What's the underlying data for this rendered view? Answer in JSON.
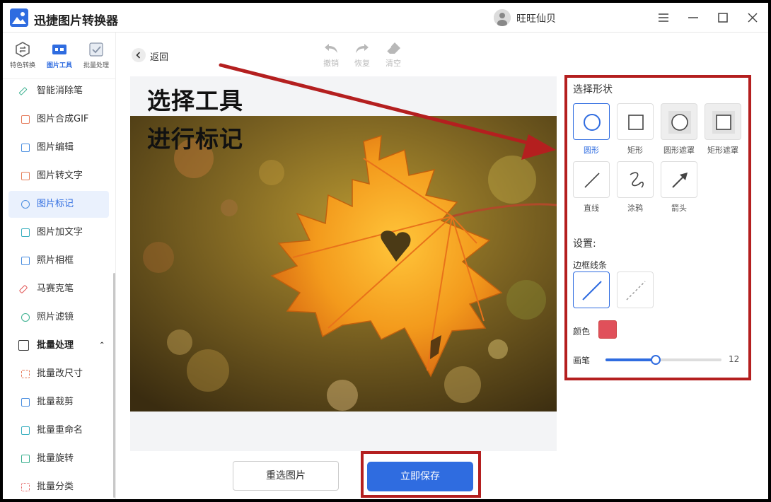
{
  "app": {
    "title": "迅捷图片转换器",
    "user_name": "旺旺仙贝"
  },
  "colors": {
    "accent": "#2f6ce0",
    "highlight_frame": "#b41f1f",
    "annotation_arrow": "#b41f1f",
    "selected_color": "#e0505a"
  },
  "window_controls": {
    "menu_icon": "hamburger-icon",
    "minimize_icon": "minimize-icon",
    "maximize_icon": "maximize-icon",
    "close_icon": "close-icon"
  },
  "nav_tabs": [
    {
      "label": "特色转换",
      "icon": "convert-icon",
      "active": false
    },
    {
      "label": "图片工具",
      "icon": "image-tools-icon",
      "active": true
    },
    {
      "label": "批量处理",
      "icon": "batch-icon",
      "active": false
    }
  ],
  "nav_items": [
    {
      "label": "智能消除笔",
      "icon": "eraser-pen-icon",
      "active": false
    },
    {
      "label": "图片合成GIF",
      "icon": "gif-icon",
      "active": false
    },
    {
      "label": "图片编辑",
      "icon": "edit-image-icon",
      "active": false
    },
    {
      "label": "图片转文字",
      "icon": "image-to-text-icon",
      "active": false
    },
    {
      "label": "图片标记",
      "icon": "mark-icon",
      "active": true
    },
    {
      "label": "图片加文字",
      "icon": "add-text-icon",
      "active": false
    },
    {
      "label": "照片相框",
      "icon": "frame-icon",
      "active": false
    },
    {
      "label": "马赛克笔",
      "icon": "mosaic-icon",
      "active": false
    },
    {
      "label": "照片滤镜",
      "icon": "filter-icon",
      "active": false
    },
    {
      "label": "批量处理",
      "icon": "batch-section-icon",
      "active": false,
      "section": true
    },
    {
      "label": "批量改尺寸",
      "icon": "resize-icon",
      "active": false
    },
    {
      "label": "批量裁剪",
      "icon": "crop-icon",
      "active": false
    },
    {
      "label": "批量重命名",
      "icon": "rename-icon",
      "active": false
    },
    {
      "label": "批量旋转",
      "icon": "rotate-icon",
      "active": false
    },
    {
      "label": "批量分类",
      "icon": "classify-icon",
      "active": false
    }
  ],
  "toolbar": {
    "back_label": "返回",
    "undo_label": "撤销",
    "redo_label": "恢复",
    "clear_label": "清空"
  },
  "overlay": {
    "line1": "选择工具",
    "line2": "进行标记"
  },
  "panel": {
    "shape_heading": "选择形状",
    "shapes": [
      {
        "label": "圆形",
        "icon": "circle-icon",
        "active": true
      },
      {
        "label": "矩形",
        "icon": "rectangle-icon",
        "active": false
      },
      {
        "label": "圆形遮罩",
        "icon": "circle-mask-icon",
        "active": false
      },
      {
        "label": "矩形遮罩",
        "icon": "rectangle-mask-icon",
        "active": false
      },
      {
        "label": "直线",
        "icon": "line-icon",
        "active": false
      },
      {
        "label": "涂鸦",
        "icon": "scribble-icon",
        "active": false
      },
      {
        "label": "箭头",
        "icon": "arrow-icon",
        "active": false
      }
    ],
    "settings_heading": "设置:",
    "border_heading": "边框线条",
    "line_styles": [
      {
        "style": "solid",
        "active": true
      },
      {
        "style": "dashed",
        "active": false
      }
    ],
    "color_label": "颜色",
    "brush_label": "画笔",
    "brush_value": "12",
    "brush_fraction": 0.43
  },
  "actions": {
    "reselect_label": "重选图片",
    "save_label": "立即保存"
  }
}
